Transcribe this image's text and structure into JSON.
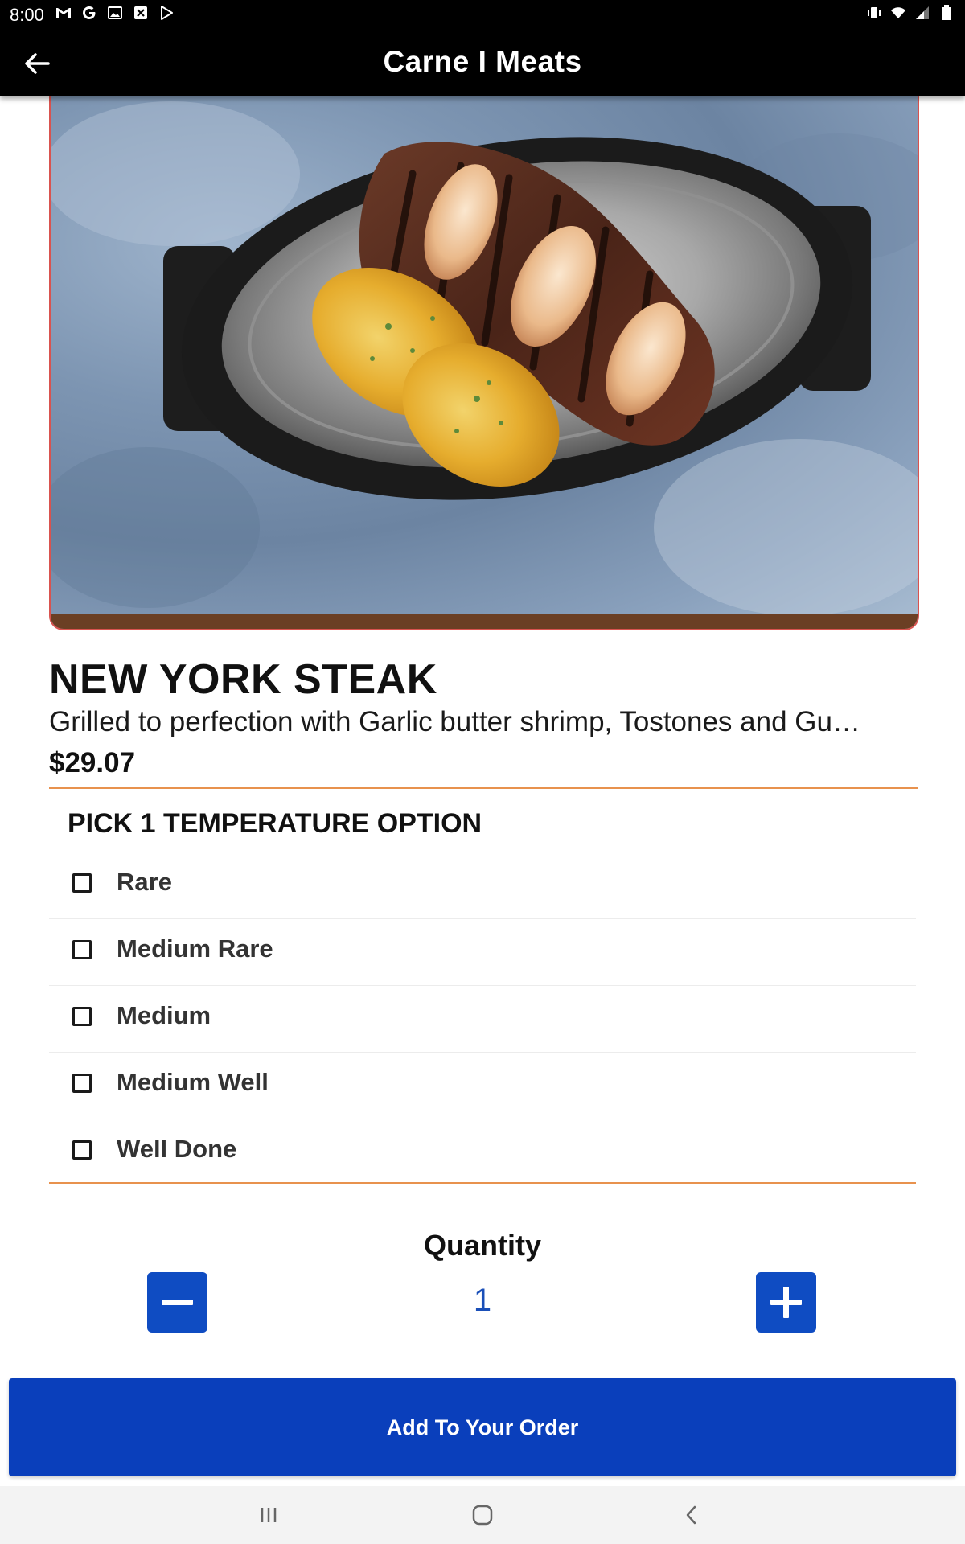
{
  "status_bar": {
    "time": "8:00",
    "left_icons": [
      "gmail-icon",
      "google-icon",
      "image-icon",
      "close-box-icon",
      "play-store-icon"
    ],
    "right_icons": [
      "vibrate-icon",
      "wifi-icon",
      "signal-icon",
      "battery-icon"
    ]
  },
  "app_bar": {
    "title": "Carne I Meats",
    "back_icon": "arrow-left-icon"
  },
  "product": {
    "name": "NEW YORK STEAK",
    "description": "Grilled to perfection with Garlic butter shrimp, Tostones and Gu…",
    "price": "$29.07"
  },
  "options_section": {
    "title": "PICK 1 TEMPERATURE OPTION",
    "options": [
      {
        "label": "Rare",
        "checked": false
      },
      {
        "label": "Medium Rare",
        "checked": false
      },
      {
        "label": "Medium",
        "checked": false
      },
      {
        "label": "Medium Well",
        "checked": false
      },
      {
        "label": "Well Done",
        "checked": false
      }
    ]
  },
  "quantity": {
    "label": "Quantity",
    "value": "1",
    "minus_icon": "minus-icon",
    "plus_icon": "plus-icon"
  },
  "add_button": {
    "label": "Add To Your Order"
  },
  "colors": {
    "primary": "#0a3fbb",
    "accent_divider": "#e8924e",
    "app_bar": "#000000"
  }
}
